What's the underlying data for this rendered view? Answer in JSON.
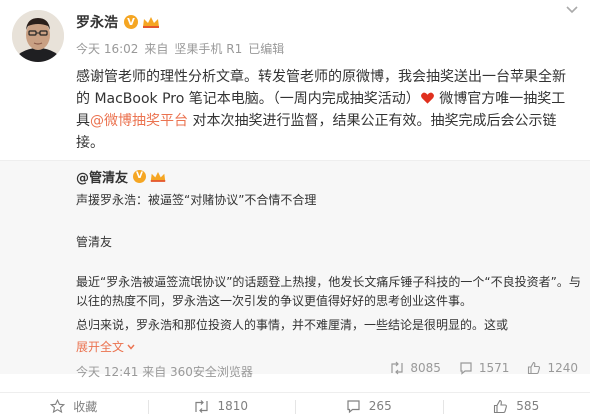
{
  "post": {
    "author": "罗永浩",
    "time": "今天 16:02",
    "source_prefix": "来自",
    "source": "坚果手机 R1",
    "edited": "已编辑",
    "lines": [
      "感谢管老师的理性分析文章。转发管老师的原微博，我会抽奖送出一台苹果全新",
      "的  MacBook Pro 笔记本电脑。（一周内完成抽奖活动）",
      " 微博官方唯一抽奖工",
      "具",
      "@微博抽奖平台",
      " 对本次抽奖进行监督，结果公正有效。抽奖完成后会公示链",
      "接。"
    ]
  },
  "repost": {
    "author": "@管清友",
    "title": "声援罗永浩：被逼签“对赌协议”不合情不合理",
    "byline": "管清友",
    "para1_line1": "最近“罗永浩被逼签流氓协议”的话题登上热搜，他发长文痛斥锤子科技的一个“不良投资者”。与",
    "para1_line2": "以往的热度不同，罗永浩这一次引发的争议更值得好好的思考创业这件事。",
    "para2_line1": "总归来说，罗永浩和那位投资人的事情，并不难厘清，一些结论是很明显的。这或",
    "expand": "展开全文",
    "foot": "今天 12:41 来自 360安全浏览器",
    "stats": {
      "reposts": "8085",
      "comments": "1571",
      "likes": "1240"
    }
  },
  "actions": {
    "favorite": "收藏",
    "repost": "1810",
    "comment": "265",
    "like": "585"
  },
  "colors": {
    "link": "#eb7350",
    "badge": "#f5a623",
    "heart": "#e0301e"
  }
}
